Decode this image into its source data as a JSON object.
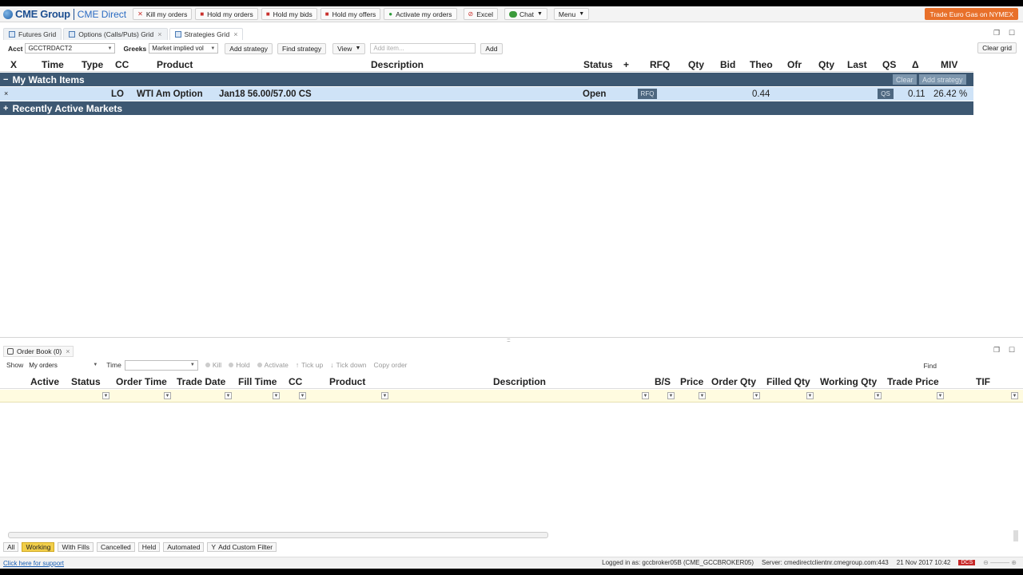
{
  "brand": {
    "name": "CME Group",
    "product": "CME Direct"
  },
  "toolbar": {
    "kill": "Kill my orders",
    "hold_orders": "Hold my orders",
    "hold_bids": "Hold my bids",
    "hold_offers": "Hold my offers",
    "activate": "Activate my orders",
    "excel": "Excel",
    "chat": "Chat",
    "menu": "Menu",
    "promo": "Trade Euro Gas on NYMEX"
  },
  "tabs": [
    {
      "label": "Futures Grid"
    },
    {
      "label": "Options (Calls/Puts) Grid"
    },
    {
      "label": "Strategies Grid"
    }
  ],
  "filters": {
    "acct_label": "Acct",
    "acct_value": "GCCTRDACT2",
    "greeks_label": "Greeks",
    "greeks_value": "Market implied vol",
    "add_strategy": "Add strategy",
    "find_strategy": "Find strategy",
    "view": "View",
    "add_item_placeholder": "Add item...",
    "add": "Add",
    "clear_grid": "Clear grid"
  },
  "grid": {
    "columns": [
      "X",
      "Time",
      "Type",
      "CC",
      "Product",
      "Description",
      "Status",
      "+",
      "RFQ",
      "Qty",
      "Bid",
      "Theo",
      "Ofr",
      "Qty",
      "Last",
      "QS",
      "Δ",
      "MIV"
    ],
    "watch_section": "My Watch Items",
    "watch_toggle": "−",
    "clear": "Clear",
    "add_strategy": "Add strategy",
    "row": {
      "x": "×",
      "cc": "LO",
      "product": "WTI Am Option",
      "description": "Jan18 56.00/57.00 CS",
      "status": "Open",
      "rfq": "RFQ",
      "theo": "0.44",
      "qs": "QS",
      "delta": "0.11",
      "miv": "26.42 %"
    },
    "recent_section": "Recently Active Markets",
    "recent_toggle": "+"
  },
  "order_book": {
    "tab": "Order Book (0)",
    "show_label": "Show",
    "show_value": "My orders",
    "time_label": "Time",
    "kill": "Kill",
    "hold": "Hold",
    "activate": "Activate",
    "tick_up": "Tick up",
    "tick_down": "Tick down",
    "copy_order": "Copy order",
    "find": "Find",
    "columns": [
      "Active",
      "Status",
      "Order Time",
      "Trade Date",
      "Fill Time",
      "CC",
      "Product",
      "Description",
      "B/S",
      "Price",
      "Order Qty",
      "Filled Qty",
      "Working Qty",
      "Trade Price",
      "TIF"
    ]
  },
  "bottom_tabs": [
    "All",
    "Working",
    "With Fills",
    "Cancelled",
    "Held",
    "Automated",
    "Add Custom Filter"
  ],
  "status_bar": {
    "support": "Click here for support",
    "logged_in": "Logged in as: gccbroker05B (CME_GCCBROKER05)",
    "server": "Server: cmedirectclientnr.cmegroup.com:443",
    "datetime": "21 Nov 2017 10:42",
    "badge": "DCS"
  }
}
